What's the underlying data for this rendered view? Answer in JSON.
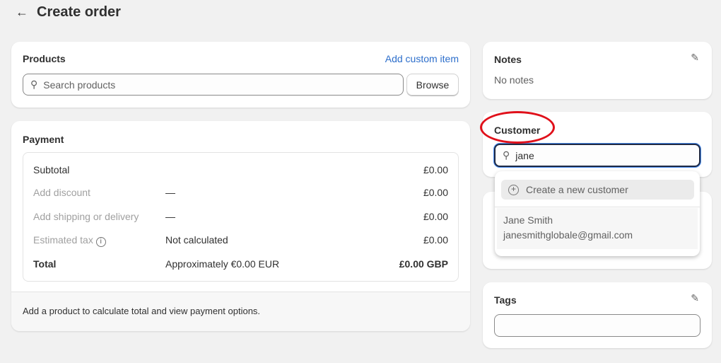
{
  "header": {
    "back_icon": "arrow-left-icon",
    "title": "Create order"
  },
  "products": {
    "title": "Products",
    "add_custom": "Add custom item",
    "search_placeholder": "Search products",
    "browse": "Browse"
  },
  "payment": {
    "title": "Payment",
    "rows": [
      {
        "label": "Subtotal",
        "middle": "",
        "value": "£0.00"
      },
      {
        "label": "Add discount",
        "middle": "—",
        "value": "£0.00"
      },
      {
        "label": "Add shipping or delivery",
        "middle": "—",
        "value": "£0.00"
      },
      {
        "label": "Estimated tax",
        "middle": "Not calculated",
        "value": "£0.00"
      },
      {
        "label": "Total",
        "middle": "Approximately €0.00 EUR",
        "value": "£0.00 GBP"
      }
    ],
    "footer": "Add a product to calculate total and view payment options."
  },
  "notes": {
    "title": "Notes",
    "value": "No notes"
  },
  "customer": {
    "title": "Customer",
    "search_value": "jane",
    "create_label": "Create a new customer",
    "results": [
      {
        "name": "Jane Smith",
        "email": "janesmithglobale@gmail.com"
      }
    ]
  },
  "tags": {
    "title": "Tags",
    "value": ""
  },
  "colors": {
    "link": "#2c6ecb",
    "annotation": "#e0101a",
    "focus": "#005bd3"
  }
}
